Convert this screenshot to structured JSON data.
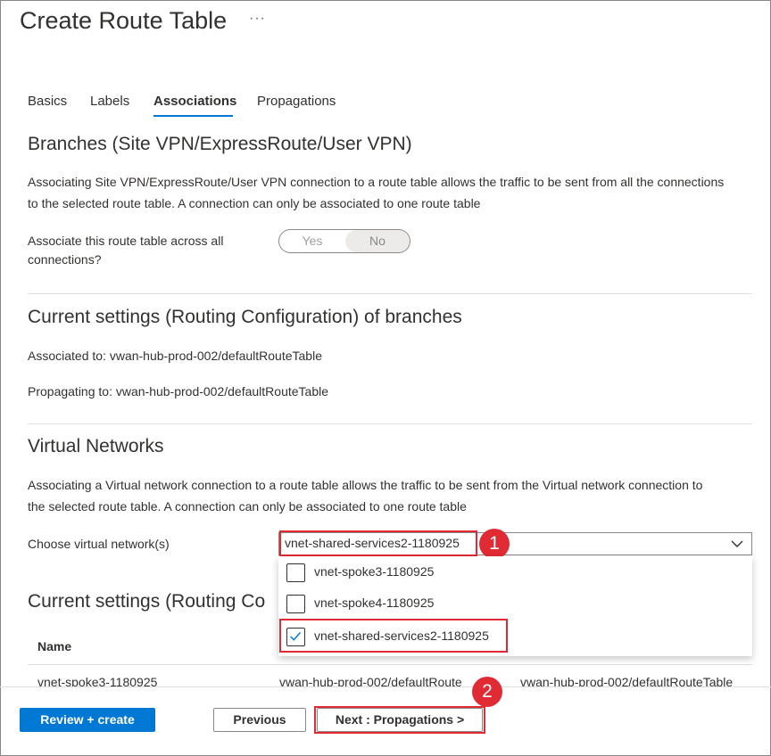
{
  "header": {
    "title": "Create Route Table",
    "more_label": "···"
  },
  "tabs": [
    {
      "label": "Basics"
    },
    {
      "label": "Labels"
    },
    {
      "label": "Associations"
    },
    {
      "label": "Propagations"
    }
  ],
  "active_tab": "Associations",
  "branches": {
    "heading": "Branches (Site VPN/ExpressRoute/User VPN)",
    "description_line1": "Associating Site VPN/ExpressRoute/User VPN connection to a route table allows the traffic to be sent from all the connections",
    "description_line2": "to the selected route table. A connection can only be associated to one route table",
    "toggle_label_line1": "Associate this route table across all",
    "toggle_label_line2": "connections?",
    "toggle_yes": "Yes",
    "toggle_no": "No",
    "toggle_selected": "No"
  },
  "branch_settings": {
    "heading": "Current settings (Routing Configuration) of branches",
    "associated": "Associated to: vwan-hub-prod-002/defaultRouteTable",
    "propagating": "Propagating to: vwan-hub-prod-002/defaultRouteTable"
  },
  "virtual_networks": {
    "heading": "Virtual Networks",
    "description_line1": "Associating a Virtual network connection to a route table allows the traffic to be sent from the Virtual network connection to",
    "description_line2": "the selected route table. A connection can only be associated to one route table",
    "choose_label": "Choose virtual network(s)",
    "selected_value": "vnet-shared-services2-1180925",
    "options": [
      {
        "label": "vnet-spoke3-1180925",
        "checked": false
      },
      {
        "label": "vnet-spoke4-1180925",
        "checked": false
      },
      {
        "label": "vnet-shared-services2-1180925",
        "checked": true
      }
    ]
  },
  "vnet_settings": {
    "heading": "Current settings (Routing Co",
    "col_name": "Name",
    "col_associated_partial": "",
    "col_propagating_partial": "",
    "row_name": "vnet-spoke3-1180925",
    "row_associated": "vwan-hub-prod-002/defaultRoute",
    "row_propagating": "vwan-hub-prod-002/defaultRouteTable"
  },
  "footer": {
    "review_create": "Review + create",
    "previous": "Previous",
    "next": "Next : Propagations >"
  },
  "annotations": {
    "badge_1": "1",
    "badge_2": "2",
    "highlight_color": "#e02a34"
  },
  "colors": {
    "accent": "#0078d4",
    "text": "#323130"
  }
}
